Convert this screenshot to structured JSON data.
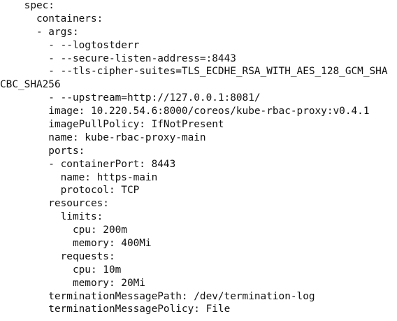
{
  "document": {
    "lines": [
      "    spec:",
      "      containers:",
      "      - args:",
      "        - --logtostderr",
      "        - --secure-listen-address=:8443",
      "        - --tls-cipher-suites=TLS_ECDHE_RSA_WITH_AES_128_GCM_SHA",
      "CBC_SHA256",
      "        - --upstream=http://127.0.0.1:8081/",
      "        image: 10.220.54.6:8000/coreos/kube-rbac-proxy:v0.4.1",
      "        imagePullPolicy: IfNotPresent",
      "        name: kube-rbac-proxy-main",
      "        ports:",
      "        - containerPort: 8443",
      "          name: https-main",
      "          protocol: TCP",
      "        resources:",
      "          limits:",
      "            cpu: 200m",
      "            memory: 400Mi",
      "          requests:",
      "            cpu: 10m",
      "            memory: 20Mi",
      "        terminationMessagePath: /dev/termination-log",
      "        terminationMessagePolicy: File"
    ]
  }
}
